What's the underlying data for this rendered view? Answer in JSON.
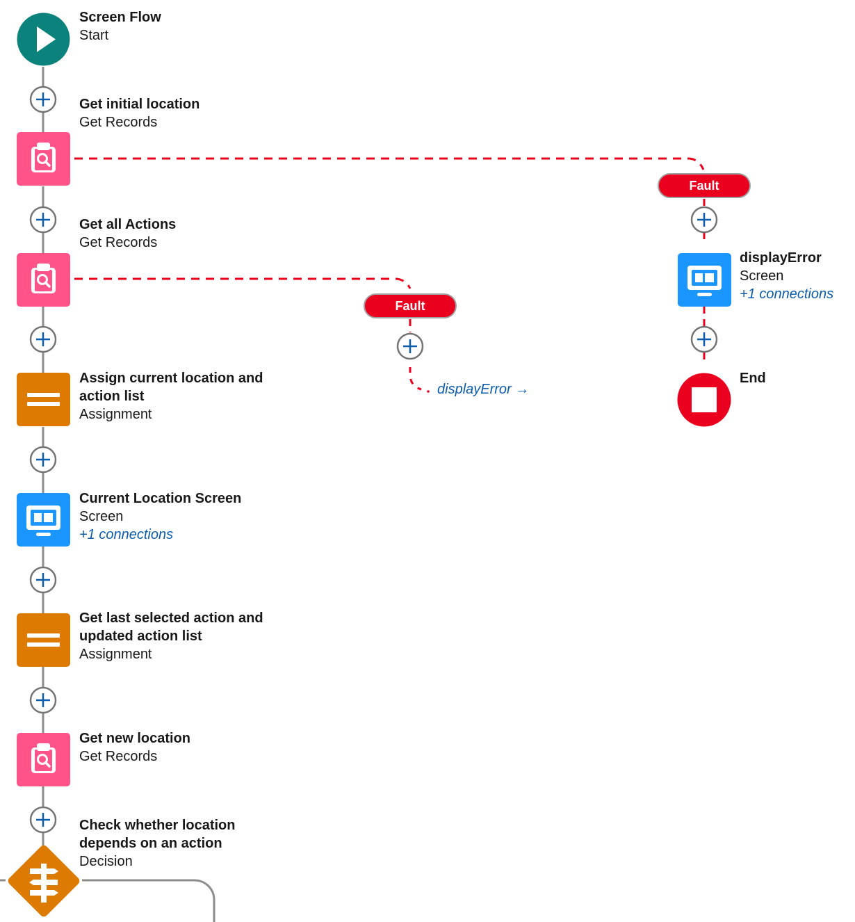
{
  "flow": {
    "start": {
      "title": "Screen Flow",
      "type": "Start"
    },
    "elements": [
      {
        "id": "get-initial-location",
        "title": "Get initial location",
        "type": "Get Records"
      },
      {
        "id": "get-all-actions",
        "title": "Get all Actions",
        "type": "Get Records"
      },
      {
        "id": "assign-current",
        "title_line1": "Assign current location and",
        "title_line2": "action list",
        "type": "Assignment"
      },
      {
        "id": "current-location-screen",
        "title": "Current Location Screen",
        "type": "Screen",
        "connections": "+1 connections"
      },
      {
        "id": "get-last-selected",
        "title_line1": "Get last selected action and",
        "title_line2": "updated action list",
        "type": "Assignment"
      },
      {
        "id": "get-new-location",
        "title": "Get new location",
        "type": "Get Records"
      },
      {
        "id": "check-location",
        "title_line1": "Check whether location",
        "title_line2": "depends on an action",
        "type": "Decision"
      }
    ],
    "fault_branches": [
      {
        "label": "Fault"
      },
      {
        "label": "Fault",
        "goto": "displayError →"
      }
    ],
    "display_error": {
      "title": "displayError",
      "type": "Screen",
      "connections": "+1 connections"
    },
    "end": {
      "title": "End"
    }
  },
  "colors": {
    "start": "#0b827c",
    "get_records": "#ff538a",
    "assignment": "#dd7a01",
    "screen": "#1b96ff",
    "decision": "#dd7a01",
    "end": "#ea001e",
    "fault": "#ea001e",
    "connector": "#8c8c8c",
    "add_button_stroke": "#747474",
    "add_button_plus": "#0b5cab",
    "link": "#0b5cab"
  },
  "icons": {
    "start": "play-icon",
    "get_records": "clipboard-search-icon",
    "assignment": "equals-icon",
    "screen": "monitor-icon",
    "decision": "signpost-icon",
    "end": "stop-icon",
    "add": "plus-circle-icon"
  }
}
